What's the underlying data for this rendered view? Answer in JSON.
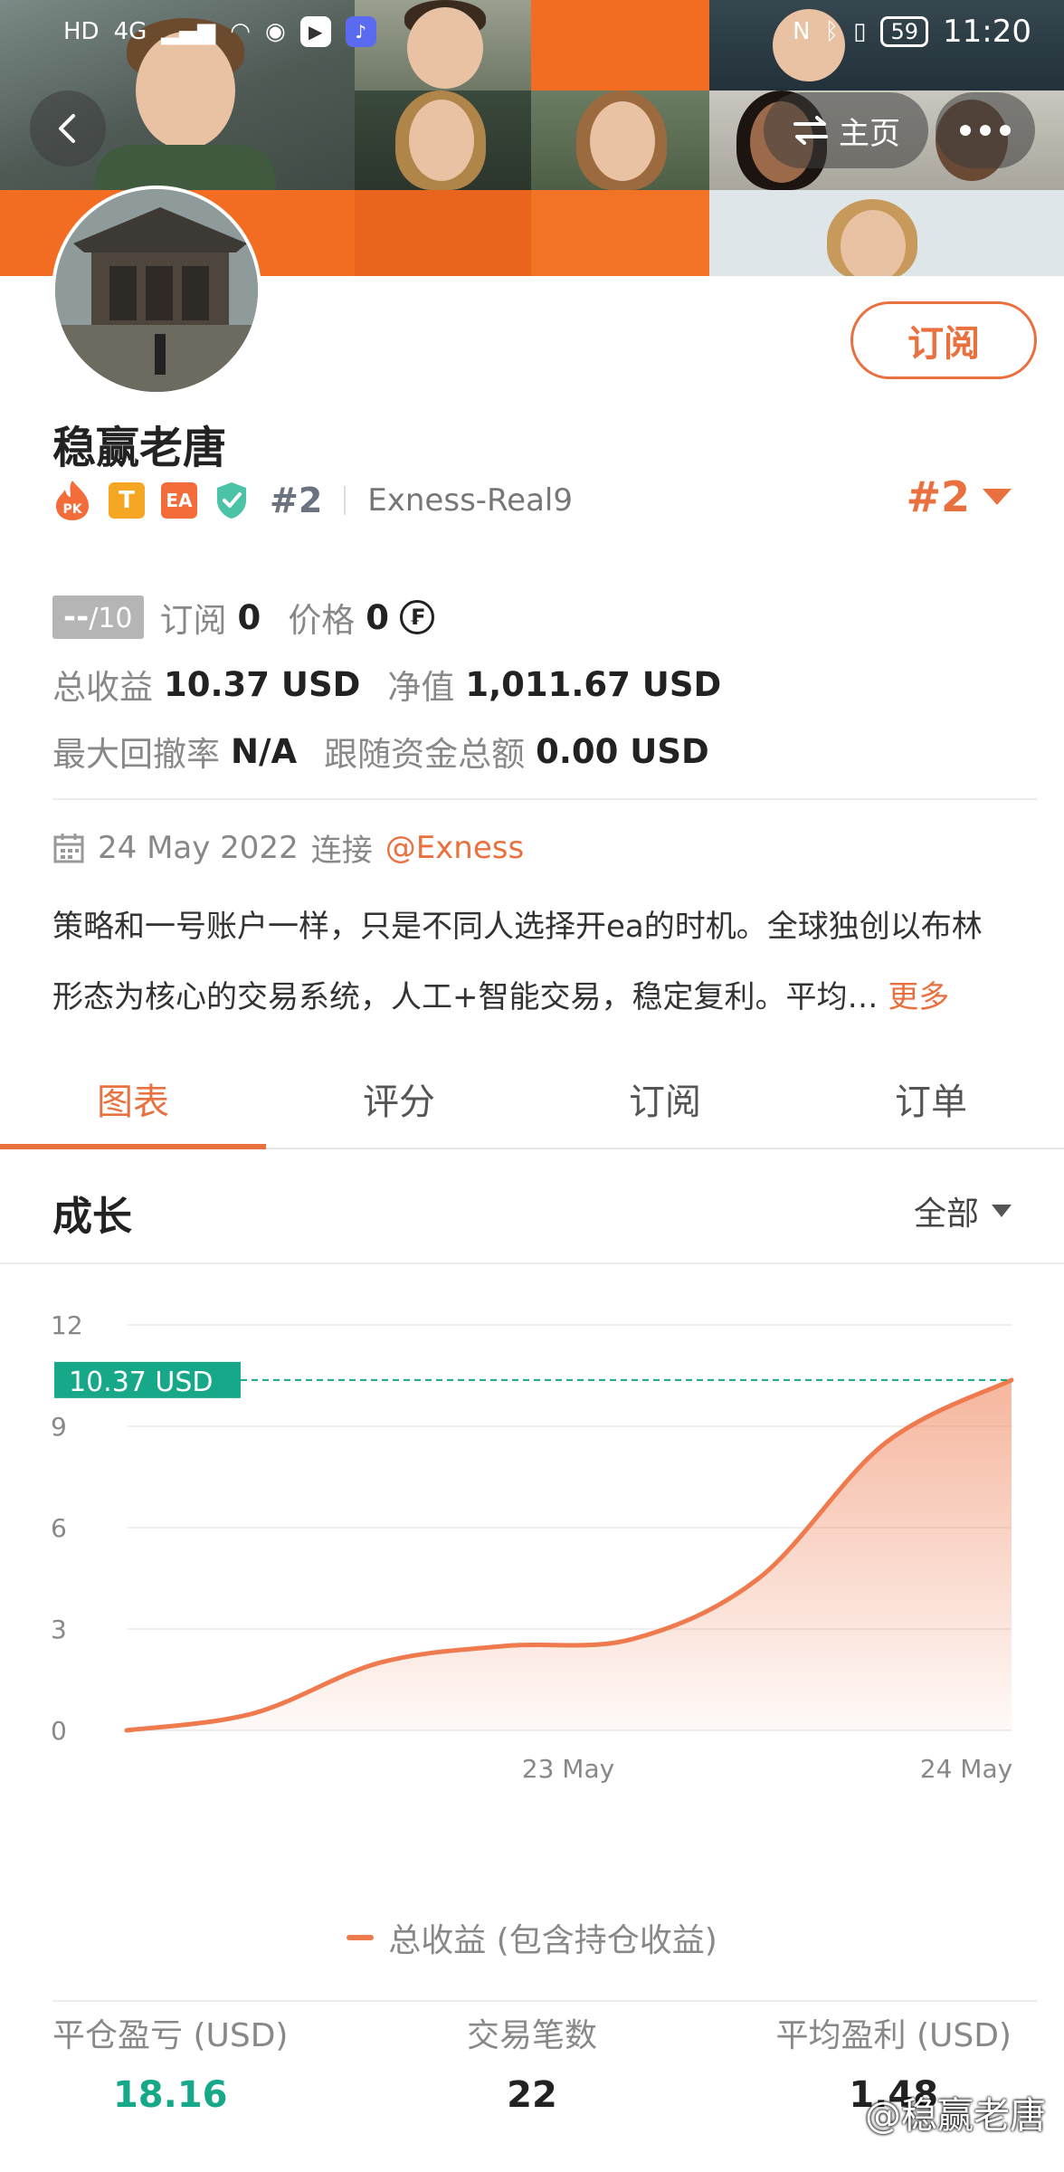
{
  "status_bar": {
    "time": "11:20",
    "battery": "59",
    "signal_label": "HD",
    "network_label": "4G"
  },
  "header": {
    "home_label": "主页"
  },
  "profile": {
    "subscribe_label": "订阅",
    "name": "稳赢老唐",
    "badge_pk": "PK",
    "badge_t": "T",
    "badge_ea": "EA",
    "rank_small": "#2",
    "broker": "Exness-Real9",
    "rank_big": "#2"
  },
  "stats": {
    "score": "--",
    "score_max": "/10",
    "subscribers_label": "订阅",
    "subscribers_value": "0",
    "price_label": "价格",
    "price_value": "0",
    "coin_symbol": "₣",
    "total_profit_label": "总收益",
    "total_profit_value": "10.37 USD",
    "equity_label": "净值",
    "equity_value": "1,011.67 USD",
    "max_drawdown_label": "最大回撤率",
    "max_drawdown_value": "N/A",
    "follow_funds_label": "跟随资金总额",
    "follow_funds_value": "0.00 USD"
  },
  "connection": {
    "date": "24 May 2022",
    "connect_label": "连接",
    "broker_link": "@Exness"
  },
  "description": {
    "line1": "策略和一号账户一样，只是不同人选择开ea的时机。全球独创以布林",
    "line2": "形态为核心的交易系统，人工+智能交易，稳定复利。平均…",
    "more_label": "更多"
  },
  "tabs": [
    "图表",
    "评分",
    "订阅",
    "订单"
  ],
  "section": {
    "title": "成长",
    "filter_label": "全部"
  },
  "chart_data": {
    "type": "area",
    "x": [
      "",
      "",
      "23 May",
      "",
      "24 May"
    ],
    "x_ticks": [
      "23 May",
      "24 May"
    ],
    "series": [
      {
        "name": "总收益 (包含持仓收益)",
        "values": [
          0,
          0.5,
          2.0,
          2.5,
          2.7,
          4.5,
          8.5,
          10.37
        ]
      }
    ],
    "yticks": [
      0,
      3,
      6,
      9,
      12
    ],
    "ylim": [
      0,
      12
    ],
    "current_value": 10.37,
    "current_label": "10.37 USD",
    "grid": true,
    "colors": {
      "line": "#ee7a4e",
      "marker": "#17a889"
    }
  },
  "legend_label": "总收益 (包含持仓收益)",
  "bottom_stats": [
    {
      "label": "平仓盈亏 (USD)",
      "value": "18.16"
    },
    {
      "label": "交易笔数",
      "value": "22"
    },
    {
      "label": "平均盈利 (USD)",
      "value": "1.48"
    }
  ],
  "watermark": "@稳赢老唐"
}
